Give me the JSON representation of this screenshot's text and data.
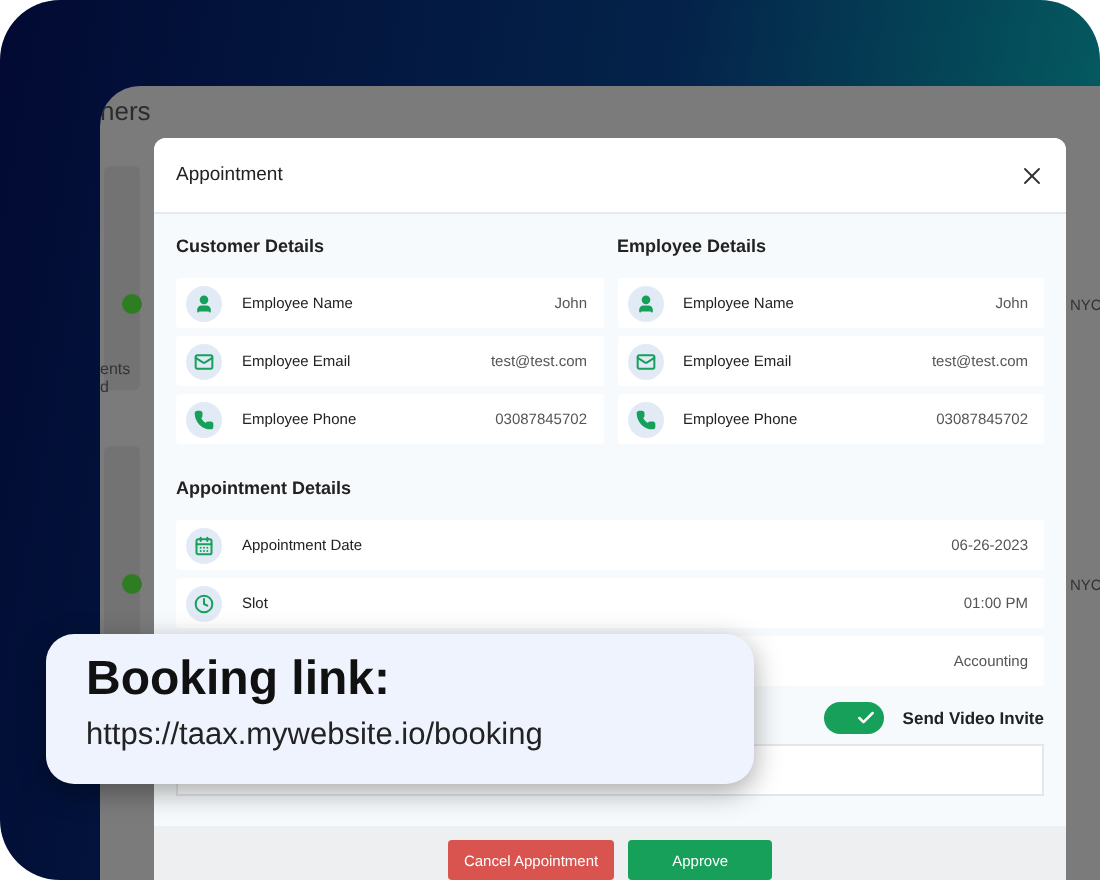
{
  "backdrop_page": {
    "title_fragment": "ners",
    "side_texts": [
      "ents",
      "d"
    ],
    "right_texts": [
      "NYC",
      "NYC"
    ]
  },
  "modal": {
    "title": "Appointment",
    "sections": [
      {
        "title": "Customer Details",
        "rows": [
          {
            "kind": "name",
            "label": "Employee Name",
            "value": "John"
          },
          {
            "kind": "email",
            "label": "Employee Email",
            "value": "test@test.com"
          },
          {
            "kind": "phone",
            "label": "Employee Phone",
            "value": "03087845702"
          }
        ]
      },
      {
        "title": "Employee Details",
        "rows": [
          {
            "kind": "name",
            "label": "Employee Name",
            "value": "John"
          },
          {
            "kind": "email",
            "label": "Employee Email",
            "value": "test@test.com"
          },
          {
            "kind": "phone",
            "label": "Employee Phone",
            "value": "03087845702"
          }
        ]
      }
    ],
    "appointment": {
      "title": "Appointment Details",
      "rows": [
        {
          "kind": "date",
          "label": "Appointment Date",
          "value": "06-26-2023"
        },
        {
          "kind": "time",
          "label": "Slot",
          "value": "01:00 PM"
        },
        {
          "kind": "other",
          "value": "Accounting"
        }
      ]
    },
    "video_invite": {
      "label": "Send Video Invite",
      "on": true
    },
    "buttons": [
      {
        "label": "Cancel Appointment",
        "kind": "danger"
      },
      {
        "label": "Approve",
        "kind": "primary"
      }
    ]
  },
  "booking_card": {
    "title": "Booking link:",
    "url": "https://taax.mywebsite.io/booking"
  }
}
